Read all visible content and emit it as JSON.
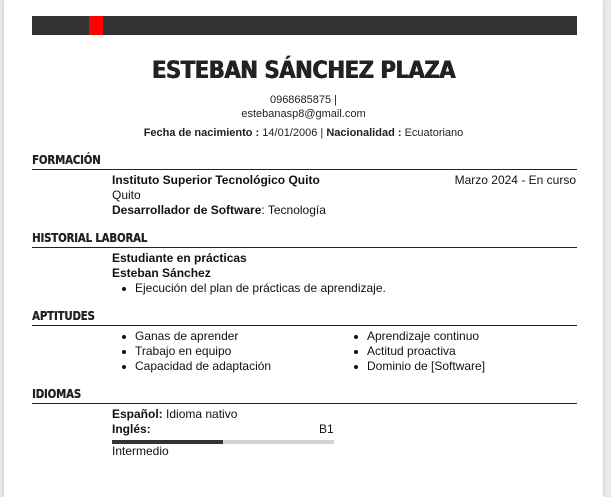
{
  "header": {
    "name": "ESTEBAN SÁNCHEZ PLAZA",
    "phone": "0968685875 |",
    "email": "estebanasp8@gmail.com",
    "birth_label": "Fecha de nacimiento :",
    "birth_value": "14/01/2006",
    "separator": "|",
    "nationality_label": "Nacionalidad :",
    "nationality_value": "Ecuatoriano"
  },
  "colors": {
    "topbar": "#333333",
    "accent": "#ff0000"
  },
  "formacion": {
    "title": "FORMACIÓN",
    "institution": "Instituto Superior Tecnológico Quito",
    "date": "Marzo 2024 - En curso",
    "city": "Quito",
    "degree_label": "Desarrollador de Software",
    "degree_value": ": Tecnología"
  },
  "historial": {
    "title": "HISTORIAL LABORAL",
    "position": "Estudiante en prácticas",
    "employer": "Esteban Sánchez",
    "tasks": [
      "Ejecución del plan de prácticas de aprendizaje."
    ]
  },
  "aptitudes": {
    "title": "APTITUDES",
    "left": [
      "Ganas de aprender",
      "Trabajo en equipo",
      "Capacidad de adaptación"
    ],
    "right": [
      "Aprendizaje continuo",
      "Actitud proactiva",
      "Dominio de [Software]"
    ]
  },
  "idiomas": {
    "title": "IDIOMAS",
    "native_label": "Español:",
    "native_value": "Idioma nativo",
    "lang2_label": "Inglés:",
    "lang2_level_code": "B1",
    "lang2_level_fraction": 0.5,
    "lang2_level_text": "Intermedio"
  }
}
